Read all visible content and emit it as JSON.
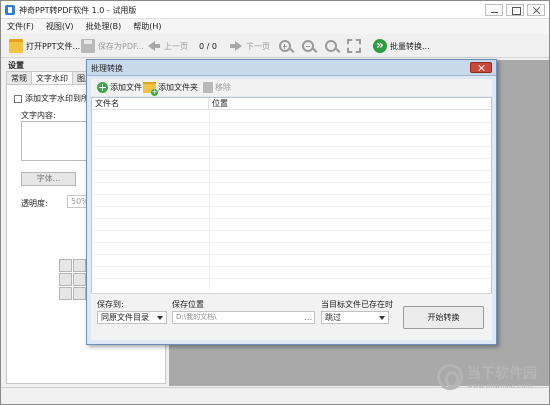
{
  "window": {
    "title": "神奇PPT转PDF软件 1.0 - 试用版"
  },
  "menu": [
    "文件(F)",
    "视图(V)",
    "批处理(B)",
    "帮助(H)"
  ],
  "toolbar": {
    "open_label": "打开PPT文件...",
    "save_label": "保存为PDF...",
    "prev_label": "上一页",
    "page_counter": "0 / 0",
    "next_label": "下一页",
    "batch_label": "批量转换..."
  },
  "settings": {
    "title": "设置",
    "tabs": [
      "常规",
      "文字水印",
      "图片水"
    ],
    "active_tab": "文字水印",
    "checkbox_label": "添加文字水印到所有",
    "text_content_label": "文字内容:",
    "font_button": "字体...",
    "opacity_label": "透明度:",
    "opacity_value": "50%"
  },
  "dialog": {
    "title": "批理转换",
    "add_file": "添加文件",
    "add_folder": "添加文件夹",
    "remove": "移除",
    "columns": [
      "文件名",
      "位置"
    ],
    "save_to_label": "保存到:",
    "save_to_value": "同原文件目录",
    "save_location_label": "保存位置",
    "save_location_value": "D:\\我的文档\\",
    "browse": "...",
    "exists_label": "当目标文件已存在时",
    "exists_value": "跳过",
    "start_button": "开始转换"
  },
  "watermark": {
    "name": "当下软件园",
    "url": "www.downxia.com"
  }
}
